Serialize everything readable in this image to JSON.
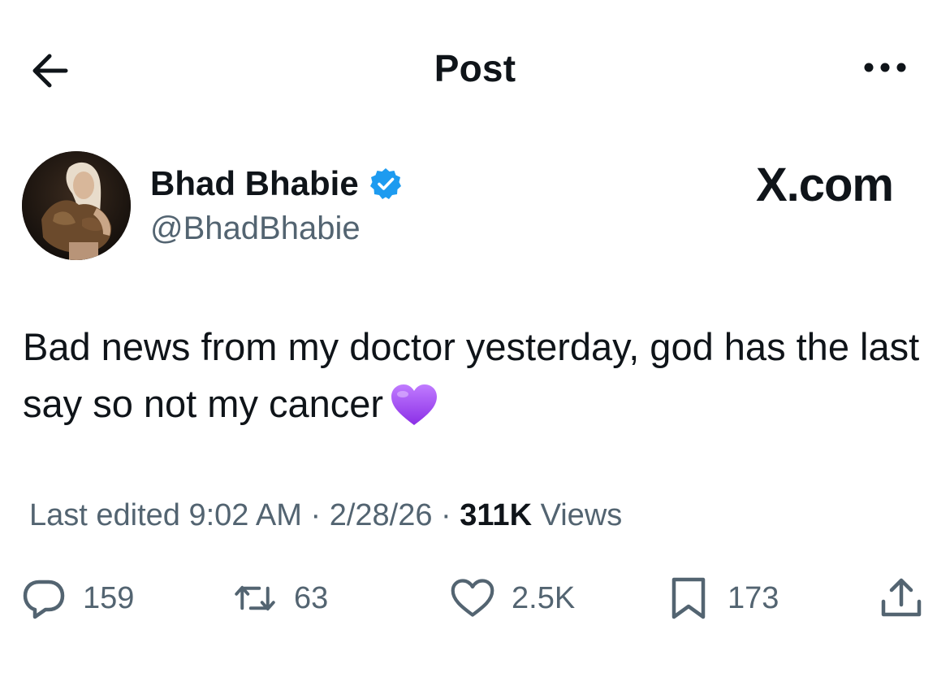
{
  "header": {
    "title": "Post",
    "back_icon": "arrow-left-icon",
    "more_icon": "more-horizontal-icon"
  },
  "author": {
    "display_name": "Bhad Bhabie",
    "handle": "@BhadBhabie",
    "verified": true,
    "verified_color": "#1d9bf0"
  },
  "source_label": "X.com",
  "post": {
    "text": "Bad news from my doctor yesterday, god has the last say so not my cancer",
    "emoji": "purple-heart"
  },
  "meta": {
    "edited_prefix": "Last edited",
    "time": "9:02 AM",
    "separator": "·",
    "date": "2/28/26",
    "views_count": "311K",
    "views_label": "Views"
  },
  "actions": {
    "replies": "159",
    "reposts": "63",
    "likes": "2.5K",
    "bookmarks": "173"
  },
  "colors": {
    "text_primary": "#0f1419",
    "text_secondary": "#536471",
    "accent": "#1d9bf0",
    "heart": "#a855f7"
  }
}
